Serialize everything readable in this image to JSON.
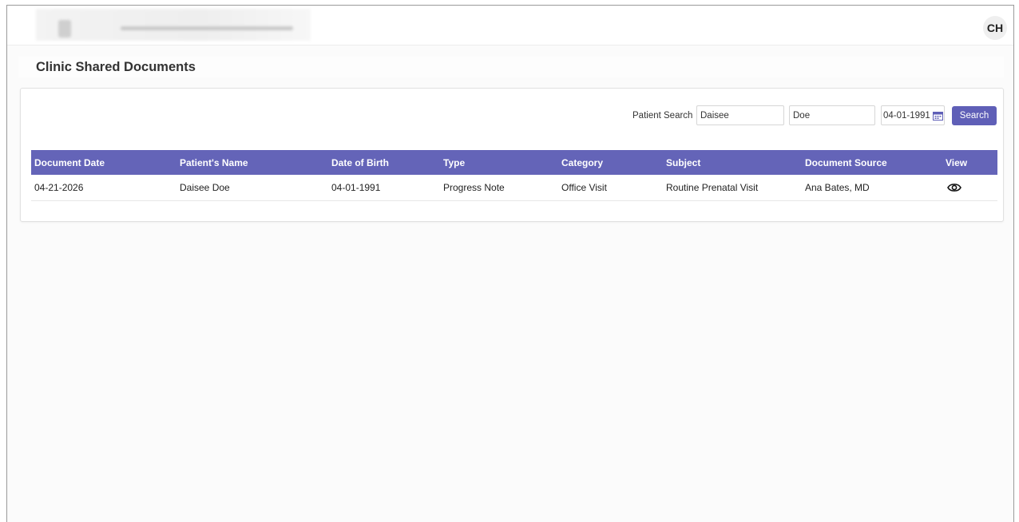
{
  "header": {
    "avatar_initials": "CH"
  },
  "page": {
    "title": "Clinic Shared Documents"
  },
  "search": {
    "label": "Patient Search",
    "first_name": "Daisee",
    "last_name": "Doe",
    "dob": "04-01-1991",
    "button_label": "Search"
  },
  "table": {
    "columns": [
      "Document Date",
      "Patient's Name",
      "Date of Birth",
      "Type",
      "Category",
      "Subject",
      "Document Source",
      "View"
    ],
    "rows": [
      {
        "document_date": "04-21-2026",
        "patient_name": "Daisee Doe",
        "dob": "04-01-1991",
        "type": "Progress Note",
        "category": "Office Visit",
        "subject": "Routine Prenatal Visit",
        "source": "Ana Bates, MD",
        "view_icon": "eye-icon"
      }
    ]
  },
  "colors": {
    "accent": "#6464b8",
    "button": "#5f5fb7"
  }
}
